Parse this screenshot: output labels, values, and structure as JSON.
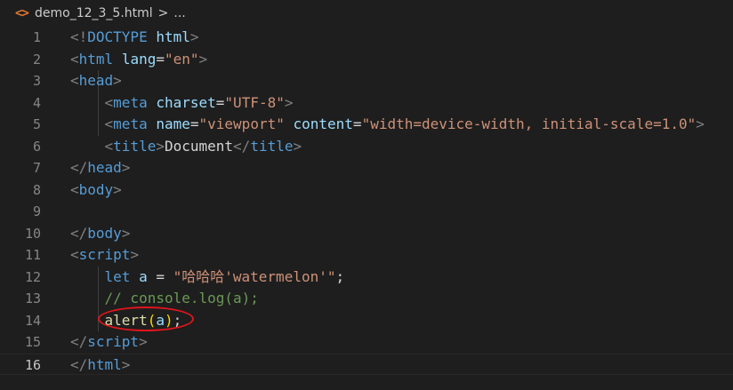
{
  "breadcrumb": {
    "file_icon": "<>",
    "filename": "demo_12_3_5.html",
    "separator": ">",
    "trail": "..."
  },
  "colors": {
    "background": "#1e1e1e",
    "tag": "#569cd6",
    "attribute": "#9cdcfe",
    "string": "#ce9178",
    "comment": "#6a9955",
    "function": "#dcdcaa",
    "annotation": "#e0151b"
  },
  "current_line": 16,
  "lines": [
    {
      "n": "1",
      "parts": [
        [
          "<!",
          "punct"
        ],
        [
          "DOCTYPE",
          "tag"
        ],
        [
          " ",
          "text"
        ],
        [
          "html",
          "attr"
        ],
        [
          ">",
          "punct"
        ]
      ]
    },
    {
      "n": "2",
      "parts": [
        [
          "<",
          "punct"
        ],
        [
          "html",
          "tag"
        ],
        [
          " ",
          "text"
        ],
        [
          "lang",
          "attr"
        ],
        [
          "=",
          "text"
        ],
        [
          "\"en\"",
          "str"
        ],
        [
          ">",
          "punct"
        ]
      ]
    },
    {
      "n": "3",
      "parts": [
        [
          "<",
          "punct"
        ],
        [
          "head",
          "tag"
        ],
        [
          ">",
          "punct"
        ]
      ]
    },
    {
      "n": "4",
      "parts": [
        [
          "    ",
          "text"
        ],
        [
          "<",
          "punct"
        ],
        [
          "meta",
          "tag"
        ],
        [
          " ",
          "text"
        ],
        [
          "charset",
          "attr"
        ],
        [
          "=",
          "text"
        ],
        [
          "\"UTF-8\"",
          "str"
        ],
        [
          ">",
          "punct"
        ]
      ]
    },
    {
      "n": "5",
      "parts": [
        [
          "    ",
          "text"
        ],
        [
          "<",
          "punct"
        ],
        [
          "meta",
          "tag"
        ],
        [
          " ",
          "text"
        ],
        [
          "name",
          "attr"
        ],
        [
          "=",
          "text"
        ],
        [
          "\"viewport\"",
          "str"
        ],
        [
          " ",
          "text"
        ],
        [
          "content",
          "attr"
        ],
        [
          "=",
          "text"
        ],
        [
          "\"width=device-width, initial-scale=1.0\"",
          "str"
        ],
        [
          ">",
          "punct"
        ]
      ]
    },
    {
      "n": "6",
      "parts": [
        [
          "    ",
          "text"
        ],
        [
          "<",
          "punct"
        ],
        [
          "title",
          "tag"
        ],
        [
          ">",
          "punct"
        ],
        [
          "Document",
          "text"
        ],
        [
          "</",
          "punct"
        ],
        [
          "title",
          "tag"
        ],
        [
          ">",
          "punct"
        ]
      ]
    },
    {
      "n": "7",
      "parts": [
        [
          "</",
          "punct"
        ],
        [
          "head",
          "tag"
        ],
        [
          ">",
          "punct"
        ]
      ]
    },
    {
      "n": "8",
      "parts": [
        [
          "<",
          "punct"
        ],
        [
          "body",
          "tag"
        ],
        [
          ">",
          "punct"
        ]
      ]
    },
    {
      "n": "9",
      "parts": []
    },
    {
      "n": "10",
      "parts": [
        [
          "</",
          "punct"
        ],
        [
          "body",
          "tag"
        ],
        [
          ">",
          "punct"
        ]
      ]
    },
    {
      "n": "11",
      "parts": [
        [
          "<",
          "punct"
        ],
        [
          "script",
          "tag"
        ],
        [
          ">",
          "punct"
        ]
      ]
    },
    {
      "n": "12",
      "parts": [
        [
          "    ",
          "text"
        ],
        [
          "let",
          "kw"
        ],
        [
          " ",
          "text"
        ],
        [
          "a",
          "var"
        ],
        [
          " = ",
          "op"
        ],
        [
          "\"哈哈哈'watermelon'\"",
          "str"
        ],
        [
          ";",
          "text"
        ]
      ]
    },
    {
      "n": "13",
      "parts": [
        [
          "    ",
          "text"
        ],
        [
          "// console.log(a);",
          "comment"
        ]
      ]
    },
    {
      "n": "14",
      "parts": [
        [
          "    ",
          "text"
        ],
        [
          "alert",
          "fn"
        ],
        [
          "(",
          "paren"
        ],
        [
          "a",
          "var"
        ],
        [
          ")",
          "paren"
        ],
        [
          ";",
          "text"
        ]
      ]
    },
    {
      "n": "15",
      "parts": [
        [
          "</",
          "punct"
        ],
        [
          "script",
          "tag"
        ],
        [
          ">",
          "punct"
        ]
      ]
    },
    {
      "n": "16",
      "parts": [
        [
          "</",
          "punct"
        ],
        [
          "html",
          "tag"
        ],
        [
          ">",
          "punct"
        ]
      ]
    }
  ]
}
